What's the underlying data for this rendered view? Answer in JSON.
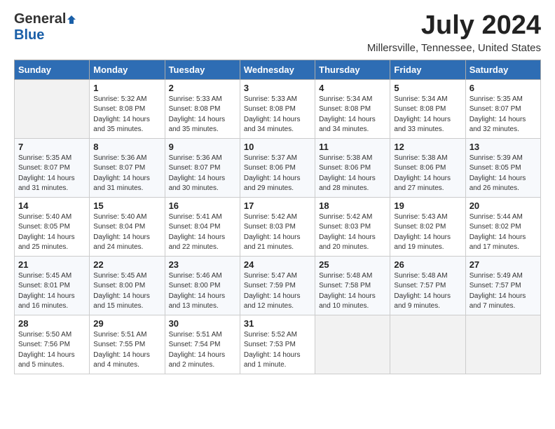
{
  "header": {
    "logo_general": "General",
    "logo_blue": "Blue",
    "month": "July 2024",
    "location": "Millersville, Tennessee, United States"
  },
  "columns": [
    "Sunday",
    "Monday",
    "Tuesday",
    "Wednesday",
    "Thursday",
    "Friday",
    "Saturday"
  ],
  "weeks": [
    [
      {
        "day": "",
        "info": ""
      },
      {
        "day": "1",
        "info": "Sunrise: 5:32 AM\nSunset: 8:08 PM\nDaylight: 14 hours\nand 35 minutes."
      },
      {
        "day": "2",
        "info": "Sunrise: 5:33 AM\nSunset: 8:08 PM\nDaylight: 14 hours\nand 35 minutes."
      },
      {
        "day": "3",
        "info": "Sunrise: 5:33 AM\nSunset: 8:08 PM\nDaylight: 14 hours\nand 34 minutes."
      },
      {
        "day": "4",
        "info": "Sunrise: 5:34 AM\nSunset: 8:08 PM\nDaylight: 14 hours\nand 34 minutes."
      },
      {
        "day": "5",
        "info": "Sunrise: 5:34 AM\nSunset: 8:08 PM\nDaylight: 14 hours\nand 33 minutes."
      },
      {
        "day": "6",
        "info": "Sunrise: 5:35 AM\nSunset: 8:07 PM\nDaylight: 14 hours\nand 32 minutes."
      }
    ],
    [
      {
        "day": "7",
        "info": "Sunrise: 5:35 AM\nSunset: 8:07 PM\nDaylight: 14 hours\nand 31 minutes."
      },
      {
        "day": "8",
        "info": "Sunrise: 5:36 AM\nSunset: 8:07 PM\nDaylight: 14 hours\nand 31 minutes."
      },
      {
        "day": "9",
        "info": "Sunrise: 5:36 AM\nSunset: 8:07 PM\nDaylight: 14 hours\nand 30 minutes."
      },
      {
        "day": "10",
        "info": "Sunrise: 5:37 AM\nSunset: 8:06 PM\nDaylight: 14 hours\nand 29 minutes."
      },
      {
        "day": "11",
        "info": "Sunrise: 5:38 AM\nSunset: 8:06 PM\nDaylight: 14 hours\nand 28 minutes."
      },
      {
        "day": "12",
        "info": "Sunrise: 5:38 AM\nSunset: 8:06 PM\nDaylight: 14 hours\nand 27 minutes."
      },
      {
        "day": "13",
        "info": "Sunrise: 5:39 AM\nSunset: 8:05 PM\nDaylight: 14 hours\nand 26 minutes."
      }
    ],
    [
      {
        "day": "14",
        "info": "Sunrise: 5:40 AM\nSunset: 8:05 PM\nDaylight: 14 hours\nand 25 minutes."
      },
      {
        "day": "15",
        "info": "Sunrise: 5:40 AM\nSunset: 8:04 PM\nDaylight: 14 hours\nand 24 minutes."
      },
      {
        "day": "16",
        "info": "Sunrise: 5:41 AM\nSunset: 8:04 PM\nDaylight: 14 hours\nand 22 minutes."
      },
      {
        "day": "17",
        "info": "Sunrise: 5:42 AM\nSunset: 8:03 PM\nDaylight: 14 hours\nand 21 minutes."
      },
      {
        "day": "18",
        "info": "Sunrise: 5:42 AM\nSunset: 8:03 PM\nDaylight: 14 hours\nand 20 minutes."
      },
      {
        "day": "19",
        "info": "Sunrise: 5:43 AM\nSunset: 8:02 PM\nDaylight: 14 hours\nand 19 minutes."
      },
      {
        "day": "20",
        "info": "Sunrise: 5:44 AM\nSunset: 8:02 PM\nDaylight: 14 hours\nand 17 minutes."
      }
    ],
    [
      {
        "day": "21",
        "info": "Sunrise: 5:45 AM\nSunset: 8:01 PM\nDaylight: 14 hours\nand 16 minutes."
      },
      {
        "day": "22",
        "info": "Sunrise: 5:45 AM\nSunset: 8:00 PM\nDaylight: 14 hours\nand 15 minutes."
      },
      {
        "day": "23",
        "info": "Sunrise: 5:46 AM\nSunset: 8:00 PM\nDaylight: 14 hours\nand 13 minutes."
      },
      {
        "day": "24",
        "info": "Sunrise: 5:47 AM\nSunset: 7:59 PM\nDaylight: 14 hours\nand 12 minutes."
      },
      {
        "day": "25",
        "info": "Sunrise: 5:48 AM\nSunset: 7:58 PM\nDaylight: 14 hours\nand 10 minutes."
      },
      {
        "day": "26",
        "info": "Sunrise: 5:48 AM\nSunset: 7:57 PM\nDaylight: 14 hours\nand 9 minutes."
      },
      {
        "day": "27",
        "info": "Sunrise: 5:49 AM\nSunset: 7:57 PM\nDaylight: 14 hours\nand 7 minutes."
      }
    ],
    [
      {
        "day": "28",
        "info": "Sunrise: 5:50 AM\nSunset: 7:56 PM\nDaylight: 14 hours\nand 5 minutes."
      },
      {
        "day": "29",
        "info": "Sunrise: 5:51 AM\nSunset: 7:55 PM\nDaylight: 14 hours\nand 4 minutes."
      },
      {
        "day": "30",
        "info": "Sunrise: 5:51 AM\nSunset: 7:54 PM\nDaylight: 14 hours\nand 2 minutes."
      },
      {
        "day": "31",
        "info": "Sunrise: 5:52 AM\nSunset: 7:53 PM\nDaylight: 14 hours\nand 1 minute."
      },
      {
        "day": "",
        "info": ""
      },
      {
        "day": "",
        "info": ""
      },
      {
        "day": "",
        "info": ""
      }
    ]
  ]
}
